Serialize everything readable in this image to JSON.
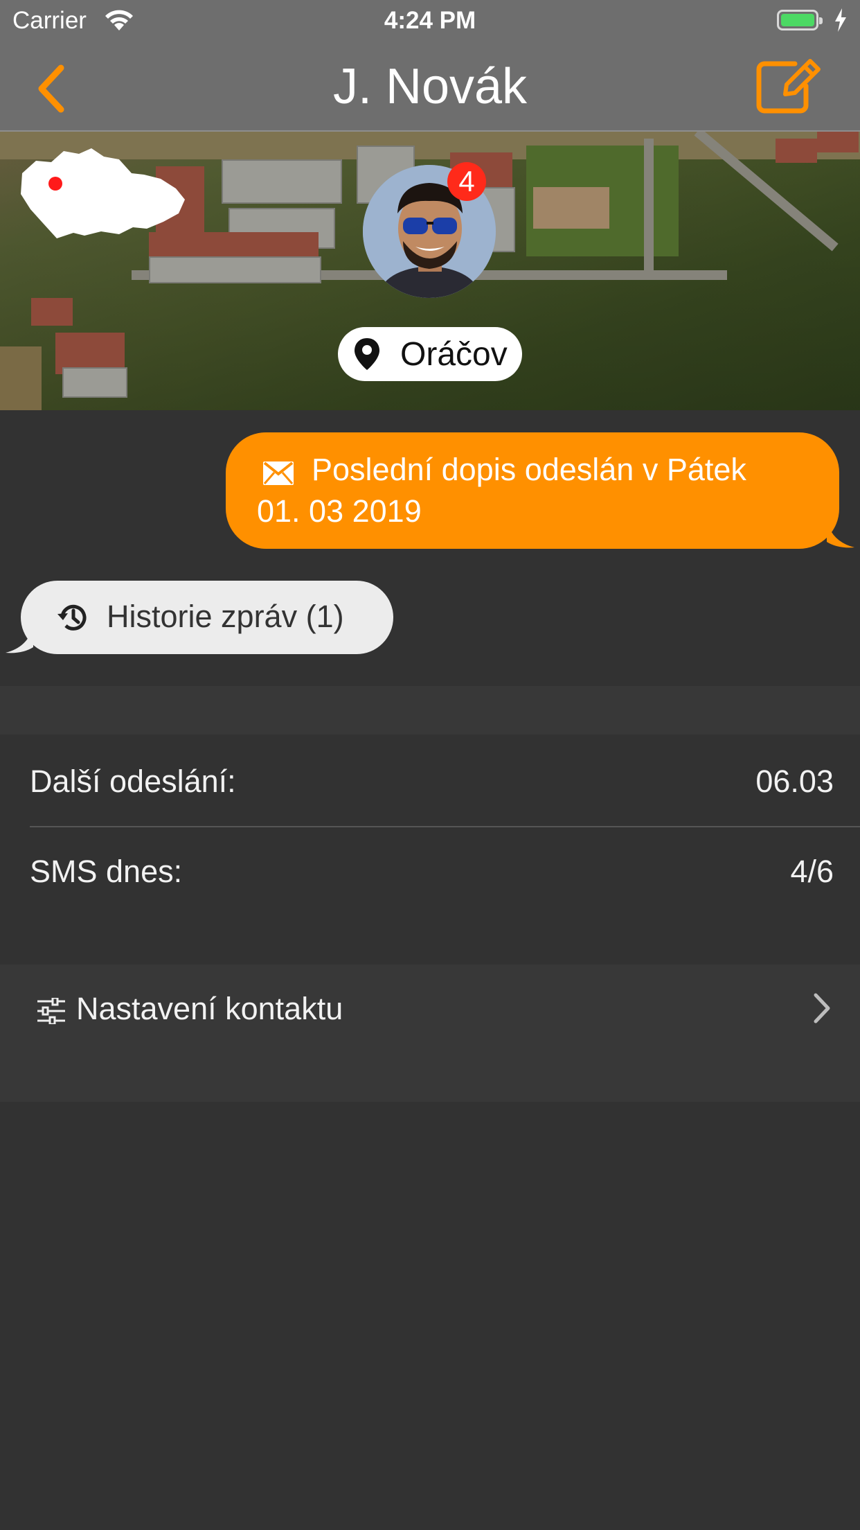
{
  "status_bar": {
    "carrier": "Carrier",
    "time": "4:24 PM"
  },
  "nav": {
    "title": "J. Novák"
  },
  "header": {
    "location": "Oráčov",
    "badge_count": "4"
  },
  "last_letter": {
    "line1": "Poslední dopis odeslán v Pátek",
    "line2": "01. 03 2019"
  },
  "history": {
    "label": "Historie zpráv (1)"
  },
  "info": {
    "next_send_label": "Další odeslání:",
    "next_send_value": "06.03",
    "sms_label": "SMS dnes:",
    "sms_value": "4/6"
  },
  "settings": {
    "label": "Nastavení kontaktu"
  },
  "colors": {
    "accent": "#ff9000",
    "badge": "#ff2a1a",
    "background": "#323232",
    "bar": "#6e6e6e"
  },
  "icons": [
    "wifi-icon",
    "battery-icon",
    "back-chevron-icon",
    "compose-icon",
    "czech-map-icon",
    "location-pin-icon",
    "mail-icon",
    "history-icon",
    "sliders-icon",
    "chevron-right-icon"
  ]
}
